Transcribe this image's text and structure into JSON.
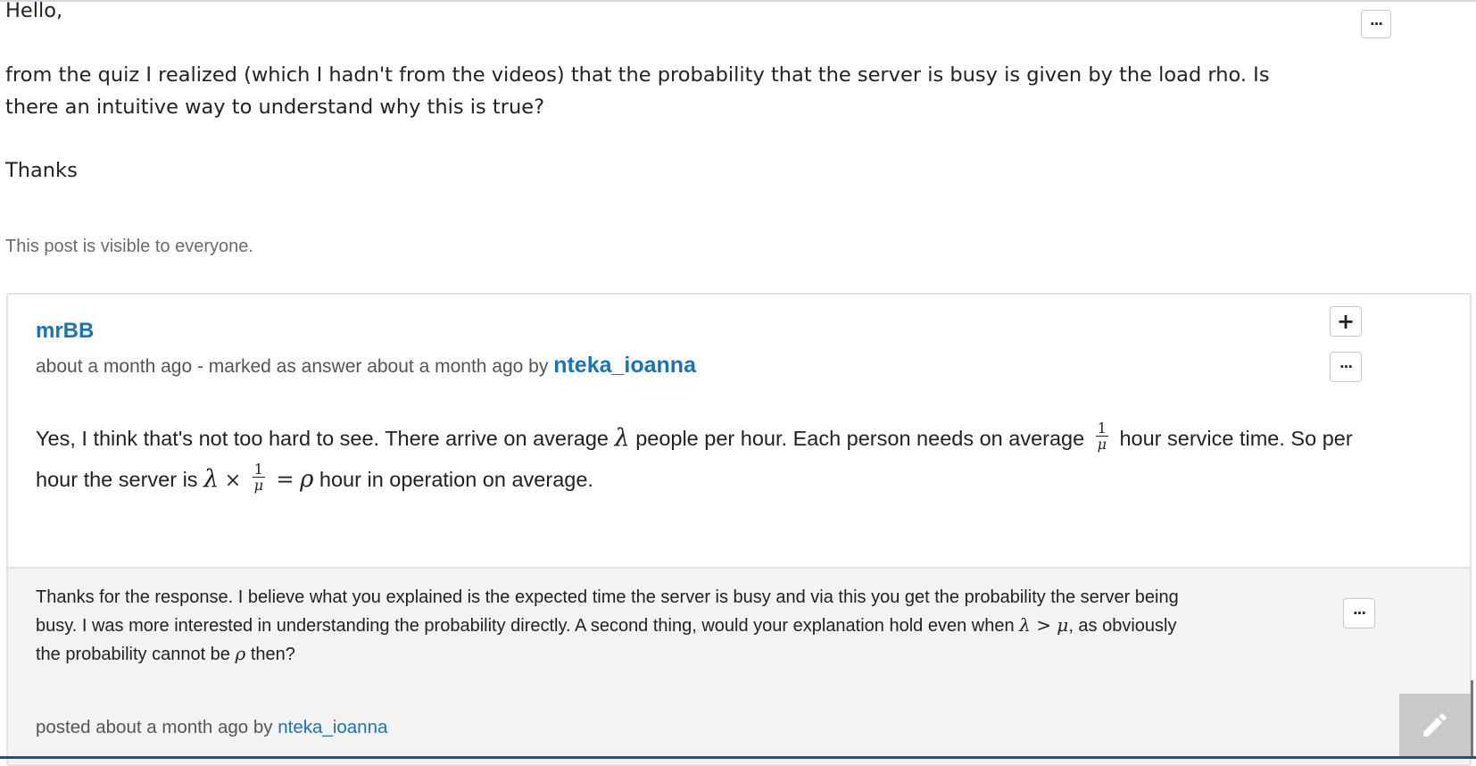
{
  "post": {
    "greeting": "Hello,",
    "question": "from the quiz I realized (which I hadn't from the videos) that the probability that the server is busy is given by the load rho. Is there an intuitive way to understand why this is true?",
    "signoff": "Thanks",
    "visibility": "This post is visible to everyone.",
    "more_label": "..."
  },
  "answer": {
    "author": "mrBB",
    "meta_prefix": "about a month ago - marked as answer about a month ago by",
    "marked_by": "nteka_ioanna",
    "plus_label": "+",
    "more_label": "...",
    "text_part1": "Yes, I think that's not too hard to see. There arrive on average",
    "lambda": "λ",
    "text_part2": "people per hour. Each person needs on average",
    "frac_num": "1",
    "frac_den": "μ",
    "text_part3": "hour service time. So per hour the server is",
    "times": "×",
    "equals": "=",
    "rho": "ρ",
    "text_part4": "hour in operation on average."
  },
  "comment": {
    "text_part1": "Thanks for the response. I believe what you explained is the expected time the server is busy and via this you get the probability the server being busy. I was more interested in understanding the probability directly. A second thing, would your explanation hold even when",
    "math_expr": "λ > μ",
    "text_part2": ", as obviously the probability cannot be",
    "rho": "ρ",
    "text_part3": "then?",
    "posted_prefix": "posted about a month ago by",
    "posted_by": "nteka_ioanna",
    "more_label": "..."
  },
  "icons": {
    "edit": "pencil-icon"
  },
  "colors": {
    "link": "#1a73b3",
    "comment_bg": "#f3f3f3",
    "fab_bg": "#c9c9c9"
  }
}
